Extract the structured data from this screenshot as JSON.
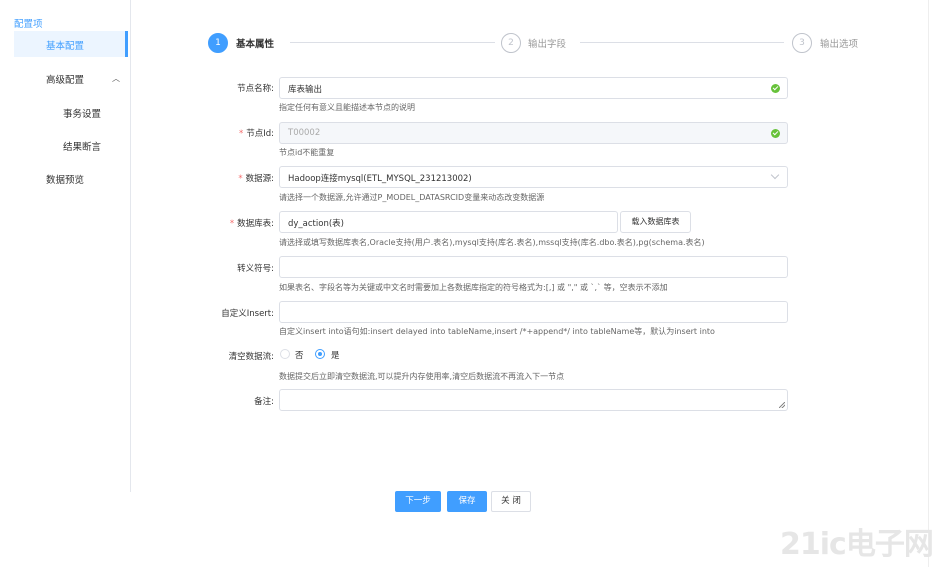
{
  "sidebar": {
    "title": "配置项",
    "items": [
      {
        "label": "基本配置"
      },
      {
        "label": "高级配置"
      },
      {
        "label": "事务设置"
      },
      {
        "label": "结果断言"
      },
      {
        "label": "数据预览"
      }
    ]
  },
  "steps": [
    {
      "num": "1",
      "label": "基本属性"
    },
    {
      "num": "2",
      "label": "输出字段"
    },
    {
      "num": "3",
      "label": "输出选项"
    }
  ],
  "form": {
    "node_name": {
      "label": "节点名称:",
      "value": "库表输出",
      "hint": "指定任何有意义且能描述本节点的说明"
    },
    "node_id": {
      "required": "*",
      "label": "节点Id:",
      "value": "T00002",
      "hint": "节点id不能重复"
    },
    "datasource": {
      "required": "*",
      "label": "数据源:",
      "value": "Hadoop连接mysql(ETL_MYSQL_231213002)",
      "hint": "请选择一个数据源,允许通过P_MODEL_DATASRCID变量来动态改变数据源"
    },
    "table": {
      "required": "*",
      "label": "数据库表:",
      "value": "dy_action(表)",
      "button": "载入数据库表",
      "hint": "请选择或填写数据库表名,Oracle支持(用户.表名),mysql支持(库名.表名),mssql支持(库名.dbo.表名),pg(schema.表名)"
    },
    "escape": {
      "label": "转义符号:",
      "value": "",
      "hint": "如果表名、字段名等为关键或中文名时需要加上各数据库指定的符号格式为:[,] 或 \",\" 或 `,` 等，空表示不添加"
    },
    "insert": {
      "label": "自定义Insert:",
      "value": "",
      "hint": "自定义insert into语句如:insert delayed into tableName,insert /*+append*/ into tableName等，默认为insert into"
    },
    "clear": {
      "label": "清空数据流:",
      "option_no": "否",
      "option_yes": "是",
      "selected": "是",
      "hint": "数据提交后立即清空数据流,可以提升内存使用率,清空后数据流不再流入下一节点"
    },
    "remark": {
      "label": "备注:",
      "value": ""
    }
  },
  "buttons": {
    "next": "下一步",
    "save": "保存",
    "close": "关 闭"
  },
  "watermark": "21ic电子网",
  "colors": {
    "accent": "#409eff",
    "success": "#67c23a",
    "required": "#f56c6c"
  }
}
